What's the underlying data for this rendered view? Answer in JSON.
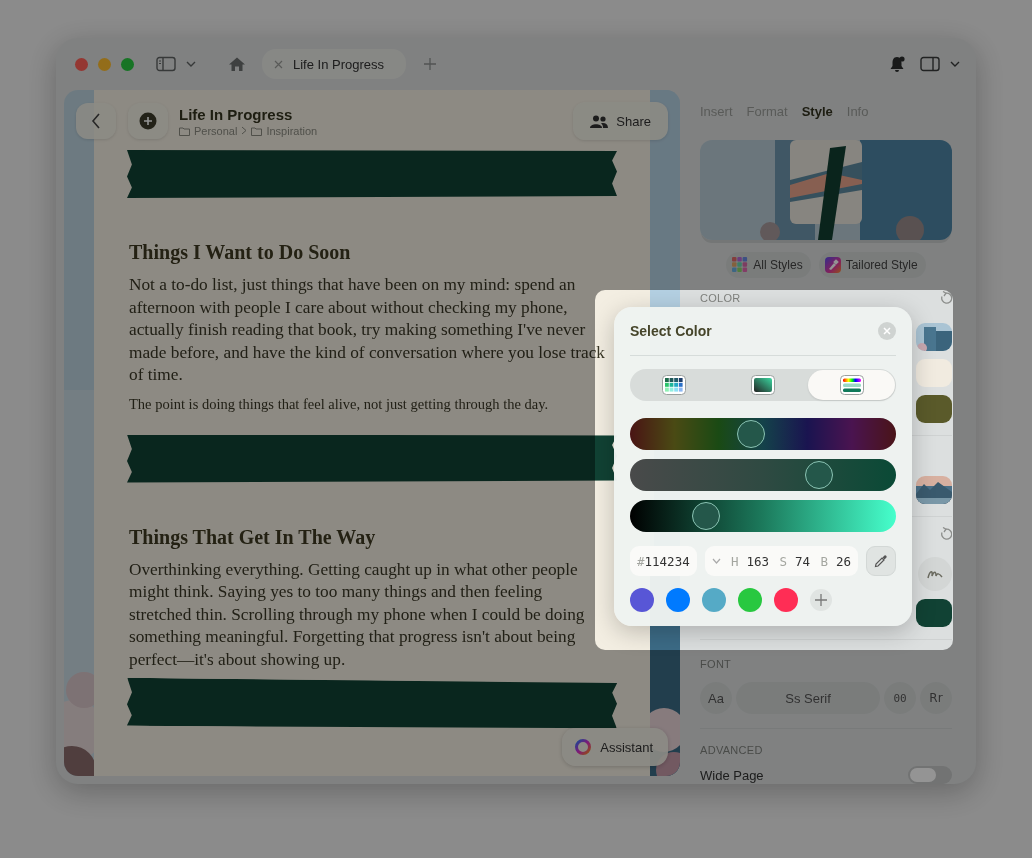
{
  "window": {
    "tab": {
      "label": "Life In Progress"
    }
  },
  "header": {
    "title": "Life In Progress",
    "breadcrumb": [
      "Personal",
      "Inspiration"
    ],
    "share": "Share"
  },
  "document": {
    "blocks": [
      {
        "kind": "tape"
      },
      {
        "kind": "heading",
        "text": "Things I Want to Do Soon"
      },
      {
        "kind": "paragraph",
        "text": "Not a to-do list, just things that have been on my mind: spend an afternoon with people I care about without checking my phone, actually finish reading that book, try making something I've never made before, and have the kind of conversation where you lose track of time."
      },
      {
        "kind": "note",
        "text": "The point is doing things that feel alive, not just getting through the day."
      },
      {
        "kind": "tape"
      },
      {
        "kind": "heading",
        "text": "Things That Get In The Way"
      },
      {
        "kind": "paragraph",
        "text": "Overthinking everything. Getting caught up in what other people might think. Saying yes to too many things and then feeling stretched thin. Scrolling through my phone when I could be doing something meaningful. Forgetting that progress isn't about being perfect—it's about showing up."
      },
      {
        "kind": "tape"
      }
    ]
  },
  "assistant": {
    "label": "Assistant"
  },
  "inspector": {
    "tabs": [
      {
        "label": "Insert",
        "selected": false
      },
      {
        "label": "Format",
        "selected": false
      },
      {
        "label": "Style",
        "selected": true
      },
      {
        "label": "Info",
        "selected": false
      }
    ],
    "style_preview": {
      "kind": "picture"
    },
    "style_buttons": [
      {
        "kind": "all",
        "label": "All Styles"
      },
      {
        "kind": "tailored",
        "label": "Tailored Style"
      }
    ],
    "color_section": {
      "title": "COLOR",
      "groups": [
        {
          "rows": [
            {
              "kind": "picture"
            },
            {
              "kind": "swatch",
              "color": "#f1ebe0"
            },
            {
              "kind": "swatch",
              "color": "#5a5a2a"
            }
          ]
        },
        {
          "rows": [
            {
              "kind": "picture"
            }
          ]
        },
        {
          "rows": [
            {
              "kind": "tools"
            },
            {
              "kind": "swatch",
              "color": "#114234"
            }
          ]
        }
      ]
    },
    "font_section": {
      "title": "FONT",
      "options": [
        {
          "kind": "sans",
          "label": "Aa",
          "selected": false
        },
        {
          "kind": "serif",
          "label": "Ss Serif",
          "selected": true
        },
        {
          "kind": "mono",
          "label": "00",
          "selected": false
        },
        {
          "kind": "rounded",
          "label": "Rr",
          "selected": false
        }
      ]
    },
    "advanced": {
      "title": "ADVANCED",
      "wide_page": {
        "label": "Wide Page",
        "on": false
      }
    }
  },
  "color_picker": {
    "title": "Select Color",
    "modes": [
      {
        "kind": "grid",
        "selected": false
      },
      {
        "kind": "spectrum",
        "selected": false
      },
      {
        "kind": "sliders",
        "selected": true
      }
    ],
    "sliders": [
      {
        "kind": "hue",
        "level": 0.453
      },
      {
        "kind": "saturation",
        "level": 0.74
      },
      {
        "kind": "brightness",
        "level": 0.26
      }
    ],
    "hex": {
      "prefix": "#",
      "value": "114234"
    },
    "hsb": [
      {
        "label": "H",
        "value": "163"
      },
      {
        "label": "S",
        "value": "74"
      },
      {
        "label": "B",
        "value": "26"
      }
    ],
    "presets": [
      {
        "color": "#5856d6"
      },
      {
        "color": "#007aff"
      },
      {
        "color": "#55aac6"
      },
      {
        "color": "#28c840"
      },
      {
        "color": "#ff2d55"
      }
    ]
  }
}
